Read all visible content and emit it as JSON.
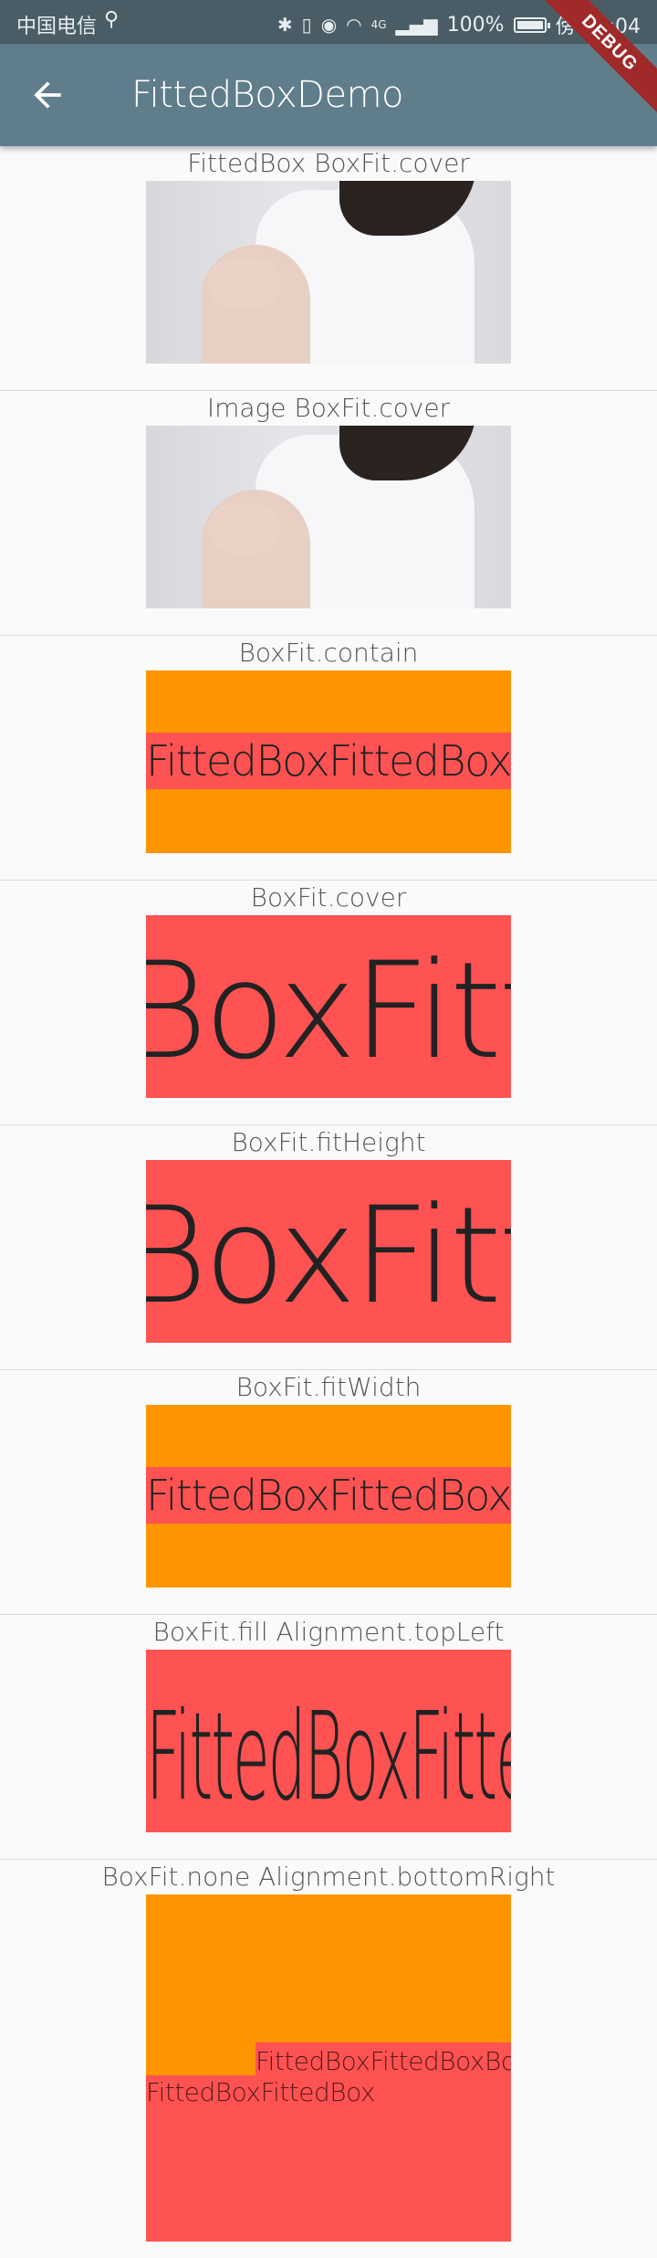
{
  "statusbar": {
    "carrier": "中国电信",
    "usb_icon": "usb-icon",
    "battery_percent": "100%",
    "time": "傍晚5:04",
    "network_label": "4G"
  },
  "appbar": {
    "title": "FittedBoxDemo",
    "back_icon": "arrow-back-icon",
    "debug_banner": "DEBUG"
  },
  "sections": [
    {
      "label": "FittedBox BoxFit.cover"
    },
    {
      "label": "Image BoxFit.cover"
    },
    {
      "label": "BoxFit.contain",
      "text": "FittedBoxFittedBox"
    },
    {
      "label": "BoxFit.cover",
      "text": "BoxFitt"
    },
    {
      "label": "BoxFit.fitHeight",
      "text": "BoxFitt"
    },
    {
      "label": "BoxFit.fitWidth",
      "text": "FittedBoxFittedBox"
    },
    {
      "label": "BoxFit.fill   Alignment.topLeft",
      "text": "FittedBoxFittedBox"
    },
    {
      "label": "BoxFit.none   Alignment.bottomRight",
      "text1": "FittedBoxFittedBoxBox",
      "text2": "FittedBoxFittedBox"
    }
  ],
  "colors": {
    "appbar": "#607d8b",
    "orange": "#ff9500",
    "red": "#ff5252"
  }
}
